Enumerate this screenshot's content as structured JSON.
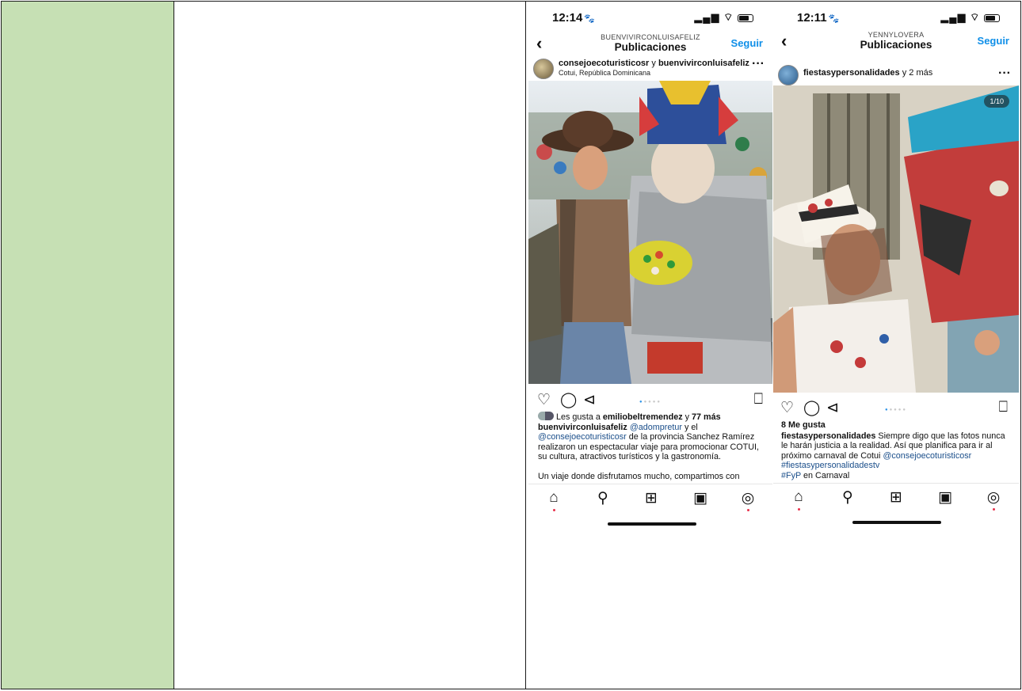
{
  "phone_left": {
    "status": {
      "time": "12:14",
      "signal": "▂▄▆",
      "wifi": "◠",
      "battery": "battery"
    },
    "nav": {
      "back": "‹",
      "account": "BUENVIVIRCONLUISAFELIZ",
      "title": "Publicaciones",
      "follow": "Seguir"
    },
    "post": {
      "authors": "consejoecoturisticosr",
      "authors_joiner": "y",
      "authors_second": "buenvivirconluisafeliz",
      "location": "Cotui, República Dominicana",
      "more": "···",
      "likes_prefix": "Les gusta a",
      "likes_user": "emiliobeltremendez",
      "likes_joiner": "y",
      "likes_count": "77 más",
      "caption_user": "buenvivirconluisafeliz",
      "caption_mention1": "@adompretur",
      "caption_text1": "y el",
      "caption_mention2": "@consejoecoturisticosr",
      "caption_text2": "de la provincia Sanchez Ramírez realizaron un espectacular viaje para promocionar COTUI, su cultura, atractivos turísticos y la gastronomía.",
      "caption_more": "Un viaje donde disfrutamos mucho, compartimos con"
    },
    "icons": {
      "like": "heart-icon",
      "comment": "comment-icon",
      "share": "share-icon",
      "save": "bookmark-icon"
    }
  },
  "phone_right": {
    "status": {
      "time": "12:11",
      "signal": "▂▄▆",
      "wifi": "◠",
      "battery": "battery"
    },
    "nav": {
      "back": "‹",
      "account": "YENNYLOVERA",
      "title": "Publicaciones",
      "follow": "Seguir"
    },
    "post": {
      "authors": "fiestasypersonalidades",
      "authors_joiner": "y 2 más",
      "more": "···",
      "counter": "1/10",
      "likes": "8 Me gusta",
      "caption_user": "fiestasypersonalidades",
      "caption_text": "Siempre digo que las fotos nunca le harán justicia a la realidad. Así que planifica para ir al próximo carnaval de Cotui",
      "caption_mention": "@consejoecoturisticosr",
      "hashtag1": "#fiestasypersonalidadestv",
      "hashtag2": "#FyP",
      "hashtag2_suffix": "en Carnaval"
    }
  },
  "colors": {
    "cell_green": "#c6e0b4",
    "instagram_blue": "#0f8fe8",
    "link_blue": "#1a4e8a",
    "notification_red": "#e8304a"
  }
}
